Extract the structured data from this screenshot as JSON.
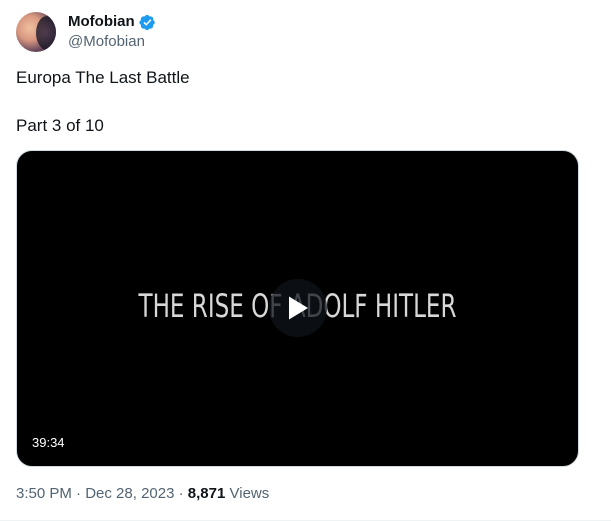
{
  "author": {
    "display_name": "Mofobian",
    "handle": "@Mofobian",
    "verified_icon": "verified-badge-icon",
    "verified_color": "#1d9bf0"
  },
  "tweet": {
    "line1": "Europa The Last Battle",
    "line2": "Part 3 of 10"
  },
  "video": {
    "frame_title": "THE RISE OF ADOLF HITLER",
    "duration": "39:34",
    "play_icon": "play-icon"
  },
  "meta": {
    "time": "3:50 PM",
    "separator": "·",
    "date": "Dec 28, 2023",
    "views_count": "8,871",
    "views_label": "Views"
  }
}
